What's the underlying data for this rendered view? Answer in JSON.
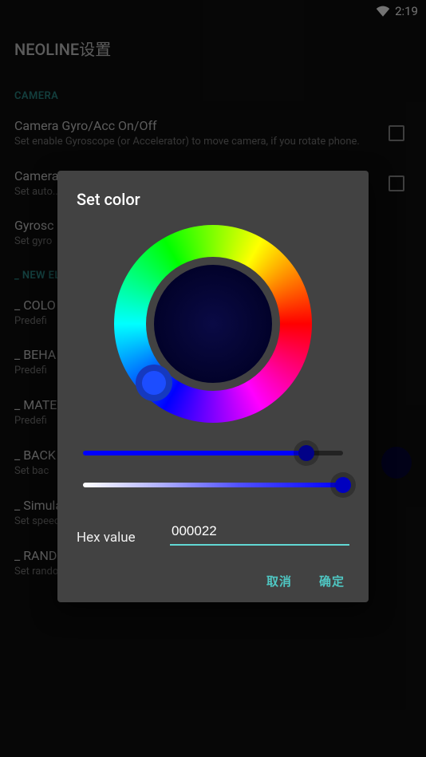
{
  "status": {
    "time": "2:19"
  },
  "appbar": {
    "title": "NEOLINE设置"
  },
  "sections": {
    "camera": "CAMERA",
    "new": "_ NEW ELEMENT"
  },
  "items": {
    "gyro": {
      "title": "Camera Gyro/Acc On/Off",
      "sub": "Set enable Gyroscope (or Accelerator) to move camera, if you rotate phone."
    },
    "camera2": {
      "title": "Camera",
      "sub": "Set auto..."
    },
    "gyrosc": {
      "title": "Gyrosc",
      "sub": "Set gyro"
    },
    "colo": {
      "title": "_ COLO",
      "sub": "Predefi"
    },
    "beha": {
      "title": "_ BEHA",
      "sub": "Predefi"
    },
    "mate": {
      "title": "_ MATE",
      "sub": "Predefi"
    },
    "back": {
      "title": "_ BACK",
      "sub": "Set bac"
    },
    "speed": {
      "title": "_ Simulation speed",
      "sub": "Set speed of simulation."
    },
    "timer": {
      "title": "_ RANDOM TIMER",
      "sub": "Set random time."
    }
  },
  "dialog": {
    "title": "Set color",
    "hex_label": "Hex value",
    "hex_value": "000022",
    "cancel": "取消",
    "confirm": "确定",
    "selected_color": "#000022",
    "saturation_pct": 86,
    "value_pct": 100
  }
}
